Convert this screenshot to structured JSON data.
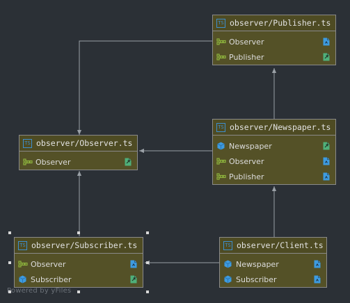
{
  "nodes": {
    "publisher": {
      "title": "observer/Publisher.ts",
      "members": [
        {
          "label": "Observer",
          "kind": "interface",
          "file_state": "plain"
        },
        {
          "label": "Publisher",
          "kind": "interface",
          "file_state": "export"
        }
      ]
    },
    "observer": {
      "title": "observer/Observer.ts",
      "members": [
        {
          "label": "Observer",
          "kind": "interface",
          "file_state": "export"
        }
      ]
    },
    "newspaper": {
      "title": "observer/Newspaper.ts",
      "members": [
        {
          "label": "Newspaper",
          "kind": "class",
          "file_state": "export"
        },
        {
          "label": "Observer",
          "kind": "interface",
          "file_state": "plain"
        },
        {
          "label": "Publisher",
          "kind": "interface",
          "file_state": "plain"
        }
      ]
    },
    "subscriber": {
      "title": "observer/Subscriber.ts",
      "members": [
        {
          "label": "Observer",
          "kind": "interface",
          "file_state": "plain"
        },
        {
          "label": "Subscriber",
          "kind": "class",
          "file_state": "export"
        }
      ]
    },
    "client": {
      "title": "observer/Client.ts",
      "members": [
        {
          "label": "Newspaper",
          "kind": "class",
          "file_state": "plain"
        },
        {
          "label": "Subscriber",
          "kind": "class",
          "file_state": "plain"
        }
      ]
    }
  },
  "edges": [
    {
      "from": "publisher",
      "to": "observer"
    },
    {
      "from": "newspaper",
      "to": "publisher"
    },
    {
      "from": "newspaper",
      "to": "observer"
    },
    {
      "from": "subscriber",
      "to": "observer"
    },
    {
      "from": "client",
      "to": "newspaper"
    },
    {
      "from": "client",
      "to": "subscriber"
    }
  ],
  "colors": {
    "background": "#2b3036",
    "node_fill": "#545127",
    "node_border": "#8a8a8a",
    "edge": "#9aa0a6",
    "interface_icon": "#8db33d",
    "class_icon": "#3d9be0",
    "file_icon_blue": "#3d9be0",
    "file_icon_green": "#4fb07a"
  },
  "footer": "Powered by yFiles"
}
